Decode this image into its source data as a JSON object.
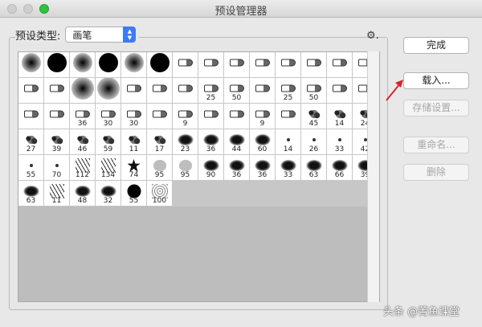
{
  "window": {
    "title": "预设管理器"
  },
  "preset_type": {
    "label": "预设类型:",
    "value": "画笔"
  },
  "buttons": {
    "done": "完成",
    "load": "载入...",
    "save": "存储设置...",
    "rename": "重命名...",
    "delete": "删除"
  },
  "brushes": [
    {
      "shape": "soft",
      "num": ""
    },
    {
      "shape": "hard",
      "num": ""
    },
    {
      "shape": "soft",
      "num": ""
    },
    {
      "shape": "hard",
      "num": ""
    },
    {
      "shape": "soft",
      "num": ""
    },
    {
      "shape": "hard",
      "num": ""
    },
    {
      "shape": "tip",
      "num": ""
    },
    {
      "shape": "tip",
      "num": ""
    },
    {
      "shape": "tip",
      "num": ""
    },
    {
      "shape": "tip",
      "num": ""
    },
    {
      "shape": "tip",
      "num": ""
    },
    {
      "shape": "tip",
      "num": ""
    },
    {
      "shape": "tip",
      "num": ""
    },
    {
      "shape": "tip",
      "num": ""
    },
    {
      "shape": "tip",
      "num": ""
    },
    {
      "shape": "tip",
      "num": ""
    },
    {
      "shape": "soft-l",
      "num": ""
    },
    {
      "shape": "soft-l",
      "num": ""
    },
    {
      "shape": "tip",
      "num": ""
    },
    {
      "shape": "tip",
      "num": ""
    },
    {
      "shape": "tip",
      "num": ""
    },
    {
      "shape": "tip",
      "num": "25"
    },
    {
      "shape": "tip",
      "num": "50"
    },
    {
      "shape": "tip",
      "num": ""
    },
    {
      "shape": "tip",
      "num": "25"
    },
    {
      "shape": "tip",
      "num": "50"
    },
    {
      "shape": "tip",
      "num": ""
    },
    {
      "shape": "tip",
      "num": ""
    },
    {
      "shape": "tip",
      "num": ""
    },
    {
      "shape": "tip",
      "num": ""
    },
    {
      "shape": "tip",
      "num": "36"
    },
    {
      "shape": "tip",
      "num": "30"
    },
    {
      "shape": "tip",
      "num": "30"
    },
    {
      "shape": "tip",
      "num": ""
    },
    {
      "shape": "tip",
      "num": "9"
    },
    {
      "shape": "tip",
      "num": ""
    },
    {
      "shape": "tip",
      "num": ""
    },
    {
      "shape": "tip",
      "num": "9"
    },
    {
      "shape": "tip",
      "num": ""
    },
    {
      "shape": "splat",
      "num": "45"
    },
    {
      "shape": "splat",
      "num": "14"
    },
    {
      "shape": "splat",
      "num": "24"
    },
    {
      "shape": "splat",
      "num": "27"
    },
    {
      "shape": "splat",
      "num": "39"
    },
    {
      "shape": "splat",
      "num": "46"
    },
    {
      "shape": "splat",
      "num": "59"
    },
    {
      "shape": "splat",
      "num": "11"
    },
    {
      "shape": "splat",
      "num": "17"
    },
    {
      "shape": "blob",
      "num": "23"
    },
    {
      "shape": "blob",
      "num": "36"
    },
    {
      "shape": "blob",
      "num": "44"
    },
    {
      "shape": "blob",
      "num": "60"
    },
    {
      "shape": "dot",
      "num": "14"
    },
    {
      "shape": "dot",
      "num": "26"
    },
    {
      "shape": "dot",
      "num": "33"
    },
    {
      "shape": "dot",
      "num": "42"
    },
    {
      "shape": "dot",
      "num": "55"
    },
    {
      "shape": "dot",
      "num": "70"
    },
    {
      "shape": "grass",
      "num": "112"
    },
    {
      "shape": "grass",
      "num": "134"
    },
    {
      "shape": "leaf",
      "num": "74"
    },
    {
      "shape": "gray",
      "num": "95"
    },
    {
      "shape": "gray",
      "num": "95"
    },
    {
      "shape": "blob",
      "num": "90"
    },
    {
      "shape": "blob",
      "num": "36"
    },
    {
      "shape": "blob",
      "num": "36"
    },
    {
      "shape": "blob",
      "num": "33"
    },
    {
      "shape": "blob",
      "num": "63"
    },
    {
      "shape": "blob",
      "num": "66"
    },
    {
      "shape": "blob",
      "num": "39"
    },
    {
      "shape": "blob",
      "num": "63"
    },
    {
      "shape": "grass",
      "num": "11"
    },
    {
      "shape": "blob",
      "num": "48"
    },
    {
      "shape": "blob",
      "num": "32"
    },
    {
      "shape": "hard-s",
      "num": "55"
    },
    {
      "shape": "tex",
      "num": "100"
    }
  ],
  "watermark": "头条 @菁鱼课堂",
  "colors": {
    "accent": "#3d7bf5",
    "arrow": "#d9252a"
  }
}
